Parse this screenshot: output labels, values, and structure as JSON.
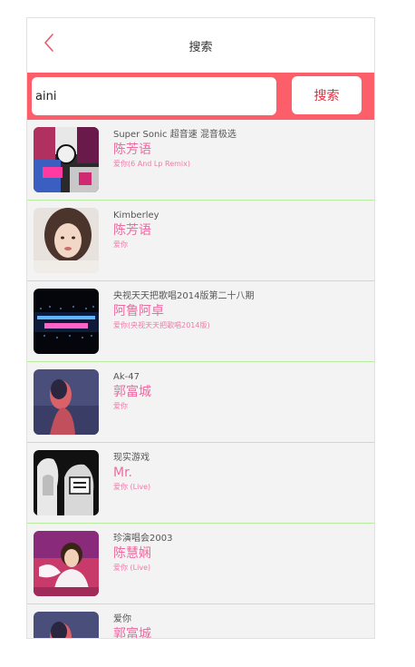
{
  "header": {
    "title": "搜索",
    "back_icon": "chevron-left-icon",
    "back_color": "#e8596b"
  },
  "search": {
    "value": "aini",
    "placeholder": "",
    "button_label": "搜索",
    "bar_color": "#fc5f6a"
  },
  "results": [
    {
      "album": "Super Sonic 超音速 混音极选",
      "artist": "陈芳语",
      "song": "爱你(6 And Lp Remix)"
    },
    {
      "album": "Kimberley",
      "artist": "陈芳语",
      "song": "爱你"
    },
    {
      "album": "央视天天把歌唱2014版第二十八期",
      "artist": "阿鲁阿卓",
      "song": "爱你(央视天天把歌唱2014版)"
    },
    {
      "album": "Ak-47",
      "artist": "郭富城",
      "song": "爱你"
    },
    {
      "album": "现实游戏",
      "artist": "Mr.",
      "song": "爱你 (Live)"
    },
    {
      "album": "珍演唱会2003",
      "artist": "陈慧娴",
      "song": "爱你 (Live)"
    },
    {
      "album": "爱你",
      "artist": "郭富城",
      "song": ""
    }
  ],
  "colors": {
    "artist": "#ef6aa0",
    "divider": "#b7ec9e",
    "list_bg": "#f3f3f3"
  }
}
